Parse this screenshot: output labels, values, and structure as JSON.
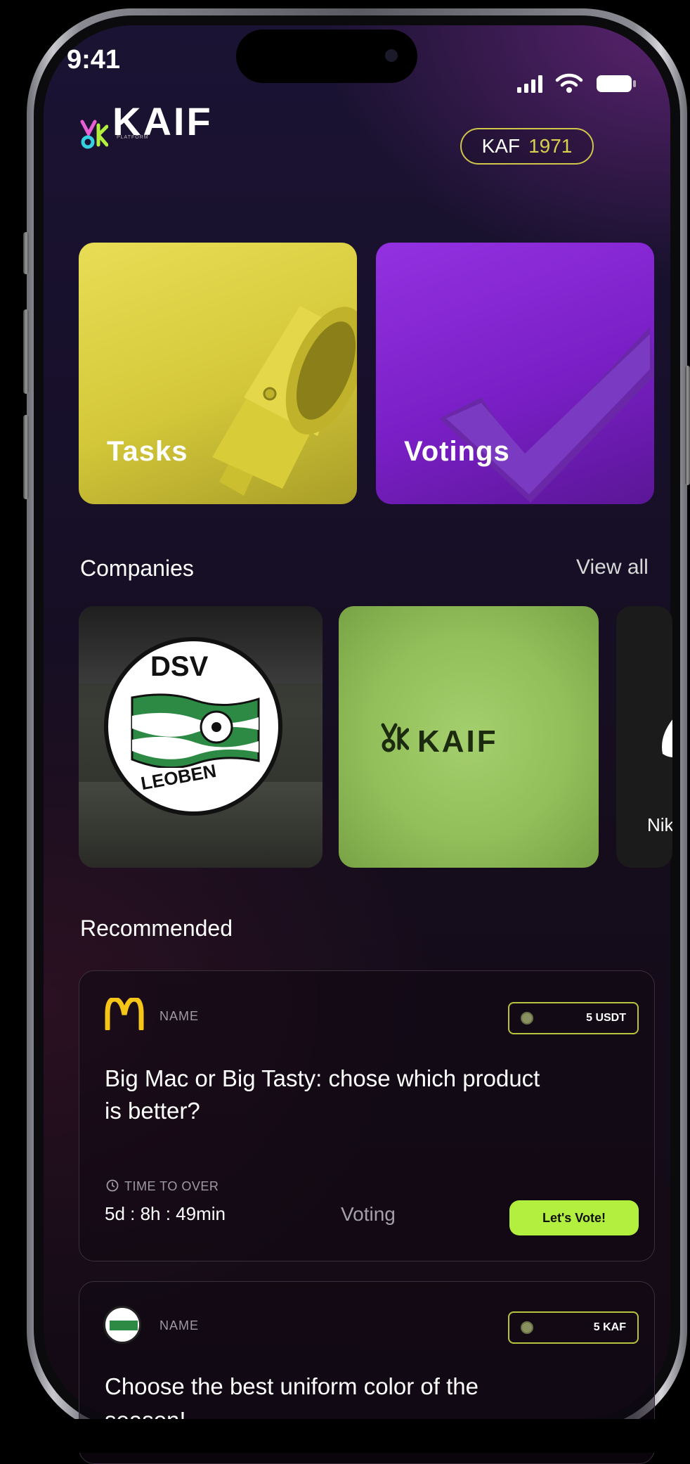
{
  "status_bar": {
    "time": "9:41"
  },
  "header": {
    "logo_name": "KAIF",
    "logo_sub": "PLATFORM",
    "balance": {
      "currency": "KAF",
      "amount": "1971"
    }
  },
  "tiles": [
    {
      "label": "Tasks"
    },
    {
      "label": "Votings"
    }
  ],
  "companies": {
    "title": "Companies",
    "view_all": "View all",
    "items": [
      {
        "name": "DSV Leoben",
        "badge_top": "DSV",
        "badge_bottom": "LEOBEN"
      },
      {
        "name": "KAIF",
        "logo_text": "KAIF"
      },
      {
        "name": "Nike",
        "label": "Nik"
      }
    ]
  },
  "recommended": {
    "title": "Recommended",
    "cards": [
      {
        "brand_label": "NAME",
        "reward": "5 USDT",
        "question_line1": "Big Mac or Big Tasty: chose which product",
        "question_line2": "is better?",
        "time_label": "TIME TO OVER",
        "time_value": "5d : 8h : 49min",
        "type": "Voting",
        "action": "Let's Vote!"
      },
      {
        "brand_label": "NAME",
        "reward": "5 KAF",
        "question_line1": "Choose the best uniform color of the",
        "question_line2": "season!"
      }
    ]
  },
  "colors": {
    "accent_green": "#b2ef3e",
    "gold": "#d9d04f",
    "tasks_yellow": "#e8dd55",
    "votings_purple": "#9331e0"
  }
}
